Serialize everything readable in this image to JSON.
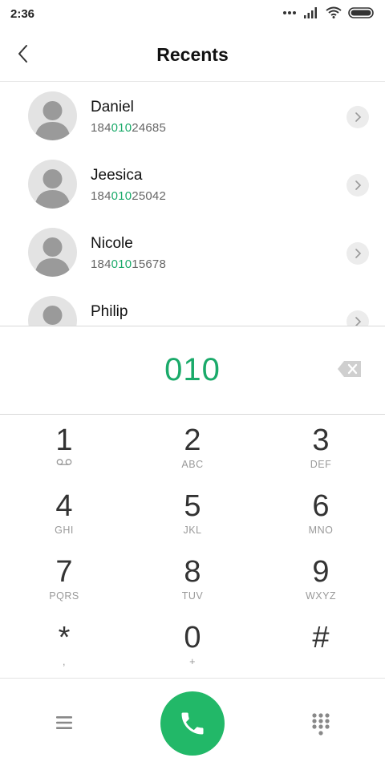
{
  "status_bar": {
    "time": "2:36"
  },
  "header": {
    "title": "Recents"
  },
  "recents": [
    {
      "name": "Daniel",
      "number_prefix": "184",
      "number_match": "010",
      "number_suffix": "24685"
    },
    {
      "name": "Jeesica",
      "number_prefix": "184",
      "number_match": "010",
      "number_suffix": "25042"
    },
    {
      "name": "Nicole",
      "number_prefix": "184",
      "number_match": "010",
      "number_suffix": "15678"
    },
    {
      "name": "Philip",
      "number_prefix": "",
      "number_match": "",
      "number_suffix": ""
    }
  ],
  "dialer": {
    "number": "010",
    "keys": [
      {
        "digit": "1",
        "letters": ""
      },
      {
        "digit": "2",
        "letters": "ABC"
      },
      {
        "digit": "3",
        "letters": "DEF"
      },
      {
        "digit": "4",
        "letters": "GHI"
      },
      {
        "digit": "5",
        "letters": "JKL"
      },
      {
        "digit": "6",
        "letters": "MNO"
      },
      {
        "digit": "7",
        "letters": "PQRS"
      },
      {
        "digit": "8",
        "letters": "TUV"
      },
      {
        "digit": "9",
        "letters": "WXYZ"
      },
      {
        "digit": "*",
        "letters": ","
      },
      {
        "digit": "0",
        "letters": "+"
      },
      {
        "digit": "#",
        "letters": ""
      }
    ]
  },
  "icons": {
    "key1_sub": "voicemail-icon",
    "call": "phone-icon",
    "menu": "menu-icon",
    "keypad_toggle": "dialpad-icon"
  },
  "colors": {
    "accent": "#1aaa6a",
    "call_button": "#22b868"
  }
}
